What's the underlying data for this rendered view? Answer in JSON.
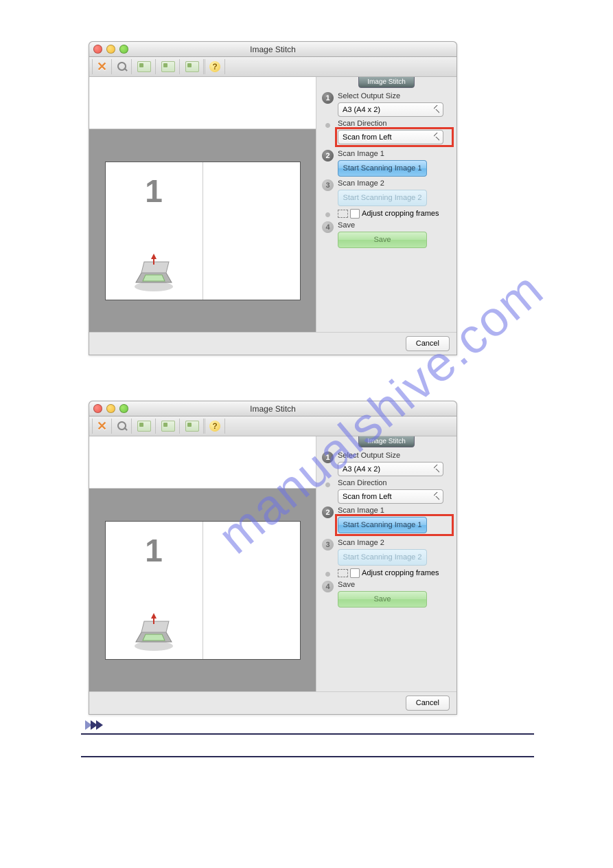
{
  "watermark": "manualshive.com",
  "win1": {
    "title": "Image Stitch",
    "panel_title": "Image Stitch",
    "step1": {
      "label": "Select Output Size",
      "select": "A3 (A4 x 2)"
    },
    "scan_dir": {
      "label": "Scan Direction",
      "select": "Scan from Left"
    },
    "step2": {
      "label": "Scan Image 1",
      "button": "Start Scanning Image 1"
    },
    "step3": {
      "label": "Scan Image 2",
      "button": "Start Scanning Image 2"
    },
    "adjust": {
      "label": "Adjust cropping frames"
    },
    "step4": {
      "label": "Save",
      "button": "Save"
    },
    "cancel": "Cancel",
    "page_number": "1"
  },
  "win2": {
    "title": "Image Stitch",
    "panel_title": "Image Stitch",
    "step1": {
      "label": "Select Output Size",
      "select": "A3 (A4 x 2)"
    },
    "scan_dir": {
      "label": "Scan Direction",
      "select": "Scan from Left"
    },
    "step2": {
      "label": "Scan Image 1",
      "button": "Start Scanning Image 1"
    },
    "step3": {
      "label": "Scan Image 2",
      "button": "Start Scanning Image 2"
    },
    "adjust": {
      "label": "Adjust cropping frames"
    },
    "step4": {
      "label": "Save",
      "button": "Save"
    },
    "cancel": "Cancel",
    "page_number": "1"
  }
}
